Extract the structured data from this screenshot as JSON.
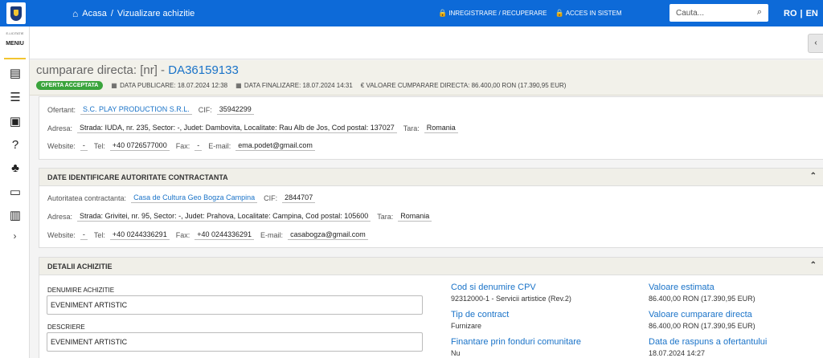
{
  "topbar": {
    "breadcrumb_home": "Acasa",
    "breadcrumb_sep": "/",
    "breadcrumb_current": "Vizualizare achizitie",
    "register_label": "INREGISTRARE / RECUPERARE",
    "login_label": "ACCES IN SISTEM",
    "search_placeholder": "Cauta...",
    "lang_ro": "RO",
    "lang_sep": "|",
    "lang_en": "EN"
  },
  "rail": {
    "brand": "E-LICITATIE",
    "menu_label": "MENIU",
    "expand": "›"
  },
  "header": {
    "title_prefix": "cumparare directa: [nr] - ",
    "code": "DA36159133",
    "badge": "OFERTA ACCEPTATA",
    "publish": "DATA PUBLICARE: 18.07.2024 12:38",
    "finalize": "DATA FINALIZARE: 18.07.2024 14:31",
    "value": "€ VALOARE CUMPARARE DIRECTA: 86.400,00  RON (17.390,95  EUR)"
  },
  "ofertant": {
    "name_label": "Ofertant:",
    "name": "S.C. PLAY PRODUCTION S.R.L.",
    "cif_label": "CIF:",
    "cif": "35942299",
    "address_label": "Adresa:",
    "address": "Strada: IUDA, nr. 235, Sector: -, Judet: Dambovita, Localitate: Rau Alb de Jos, Cod postal: 137027",
    "country_label": "Tara:",
    "country": "Romania",
    "website_label": "Website:",
    "website": "-",
    "tel_label": "Tel:",
    "tel": "+40 0726577000",
    "fax_label": "Fax:",
    "fax": "-",
    "email_label": "E-mail:",
    "email": "ema.podet@gmail.com"
  },
  "authority": {
    "heading": "DATE IDENTIFICARE AUTORITATE CONTRACTANTA",
    "name_label": "Autoritatea contractanta:",
    "name": "Casa de Cultura Geo Bogza Campina",
    "cif_label": "CIF:",
    "cif": "2844707",
    "address_label": "Adresa:",
    "address": "Strada: Grivitei, nr. 95, Sector: -, Judet: Prahova, Localitate: Campina, Cod postal: 105600",
    "country_label": "Tara:",
    "country": "Romania",
    "website_label": "Website:",
    "website": "-",
    "tel_label": "Tel:",
    "tel": "+40 0244336291",
    "fax_label": "Fax:",
    "fax": "+40 0244336291",
    "email_label": "E-mail:",
    "email": "casabogza@gmail.com"
  },
  "details": {
    "heading": "DETALII ACHIZITIE",
    "name_label": "DENUMIRE ACHIZITIE",
    "name_value": "EVENIMENT ARTISTIC",
    "desc_label": "DESCRIERE",
    "desc_value": "EVENIMENT ARTISTIC",
    "cpv_title": "Cod si denumire CPV",
    "cpv_value": "92312000-1 - Servicii artistice (Rev.2)",
    "contract_title": "Tip de contract",
    "contract_value": "Furnizare",
    "eu_title": "Finantare prin fonduri comunitare",
    "eu_value": "Nu",
    "est_title": "Valoare estimata",
    "est_value": "86.400,00  RON (17.390,95  EUR)",
    "direct_title": "Valoare cumparare directa",
    "direct_value": "86.400,00  RON (17.390,95  EUR)",
    "deadline_title": "Data de raspuns a ofertantului",
    "deadline_value": "18.07.2024 14:27"
  },
  "colors": {
    "topbar": "#0d6ad8",
    "link": "#1a73c8",
    "badge": "#3aa43c",
    "accent": "#f2c530"
  }
}
